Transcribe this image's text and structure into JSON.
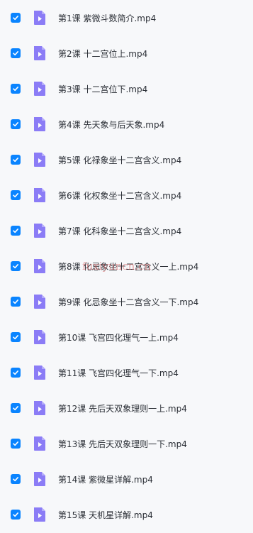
{
  "accent_color": "#0a84ff",
  "file_icon_color": "#8b7cf6",
  "watermark": "fuxiyuncn.cn",
  "files": [
    {
      "name": "第1课 紫微斗数简介.mp4",
      "checked": true
    },
    {
      "name": "第2课 十二宫位上.mp4",
      "checked": true
    },
    {
      "name": "第3课 十二宫位下.mp4",
      "checked": true
    },
    {
      "name": "第4课 先天象与后天象.mp4",
      "checked": true
    },
    {
      "name": "第5课 化禄象坐十二宫含义.mp4",
      "checked": true
    },
    {
      "name": "第6课 化权象坐十二宫含义.mp4",
      "checked": true
    },
    {
      "name": "第7课 化科象坐十二宫含义.mp4",
      "checked": true
    },
    {
      "name": "第8课 化忌象坐十二宫含义一上.mp4",
      "checked": true
    },
    {
      "name": "第9课 化忌象坐十二宫含义一下.mp4",
      "checked": true
    },
    {
      "name": "第10课 飞宫四化理气一上.mp4",
      "checked": true
    },
    {
      "name": "第11课 飞宫四化理气一下.mp4",
      "checked": true
    },
    {
      "name": "第12课 先后天双象理则一上.mp4",
      "checked": true
    },
    {
      "name": "第13课 先后天双象理则一下.mp4",
      "checked": true
    },
    {
      "name": "第14课 紫微星详解.mp4",
      "checked": true
    },
    {
      "name": "第15课 天机星详解.mp4",
      "checked": true
    }
  ]
}
